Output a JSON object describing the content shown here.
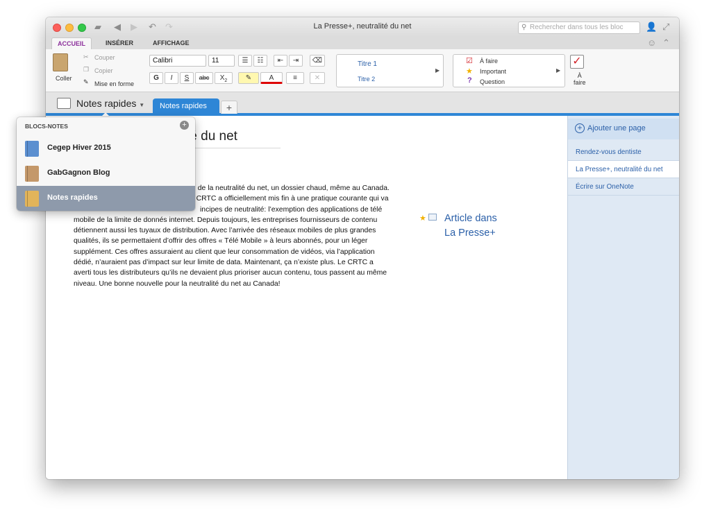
{
  "window": {
    "title": "La Presse+, neutralité du net"
  },
  "search": {
    "placeholder": "Rechercher dans tous les bloc"
  },
  "ribbon_tabs": [
    {
      "label": "ACCUEIL",
      "active": true
    },
    {
      "label": "INSÉRER",
      "active": false
    },
    {
      "label": "AFFICHAGE",
      "active": false
    }
  ],
  "clipboard": {
    "paste": "Coller",
    "cut": "Couper",
    "copy": "Copier",
    "format": "Mise en forme"
  },
  "font": {
    "name": "Calibri",
    "size": "11",
    "bold": "G",
    "italic": "I",
    "underline": "S",
    "strike": "abc",
    "sub": "X",
    "sub2": "2",
    "color_a": "A"
  },
  "styles": {
    "items": [
      "Titre 1",
      "Titre 2"
    ]
  },
  "tags": {
    "items": [
      "À faire",
      "Important",
      "Question"
    ],
    "todo_big_l1": "À",
    "todo_big_l2": "faire"
  },
  "notebook": {
    "current": "Notes rapides",
    "section_tab": "Notes rapides",
    "add_section": "+"
  },
  "notebooks_panel": {
    "header": "BLOCS-NOTES",
    "items": [
      {
        "name": "Cegep Hiver 2015",
        "color": "#5b8fd0"
      },
      {
        "name": "GabGagnon Blog",
        "color": "#c4986a"
      },
      {
        "name": "Notes rapides",
        "color": "#e2b45a",
        "selected": true
      }
    ]
  },
  "page": {
    "title": "té du net",
    "body_lines": [
      "ps, de la neutralité du net, un dossier chaud, même au Canada.",
      "e CRTC a officiellement mis fin à une pratique courante qui va",
      "incipes de neutralité: l’exemption des applications de télé",
      "mobile de la limite de donnés internet.  Depuis toujours, les entreprises fournisseurs de contenu",
      "détiennent aussi les tuyaux de distribution. Avec l’arrivée des réseaux mobiles de plus grandes",
      "qualités, ils se permettaient d’offrir des offres « Télé Mobile » à leurs abonnés, pour un léger",
      "supplément. Ces offres assuraient au client  que leur consommation de vidéos, via l’application",
      "dédié, n’auraient pas d’impact sur leur limite de data.  Maintenant, ça n’existe plus. Le CRTC a",
      "averti tous les distributeurs qu’ils ne devaient plus prioriser aucun contenu, tous passent au même",
      "niveau. Une bonne nouvelle pour la neutralité  du net au Canada!"
    ],
    "article_link_l1": "Article dans",
    "article_link_l2": "La Presse+"
  },
  "pages_list": {
    "add_label": "Ajouter une page",
    "items": [
      {
        "label": "Rendez-vous dentiste"
      },
      {
        "label": "La Presse+, neutralité du net",
        "active": true
      },
      {
        "label": "Écrire sur OneNote"
      }
    ]
  }
}
